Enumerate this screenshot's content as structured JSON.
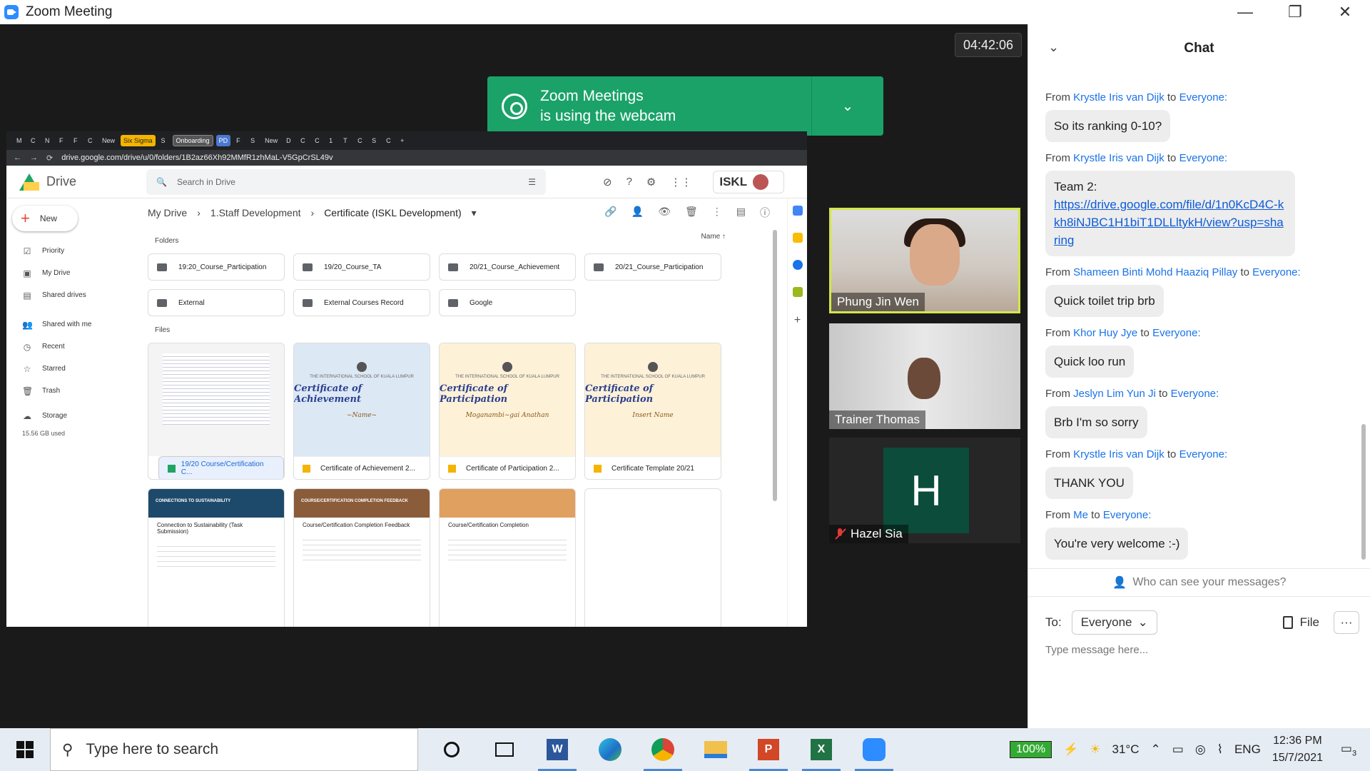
{
  "window": {
    "title": "Zoom Meeting",
    "minimize": "—",
    "restore": "❐",
    "close": "✕"
  },
  "meeting": {
    "timer": "04:42:06"
  },
  "notification": {
    "line1": "Zoom Meetings",
    "line2": "is using the webcam",
    "expand": "⌄"
  },
  "browser": {
    "url": "drive.google.com/drive/u/0/folders/1B2az66Xh92MMfR1zhMaL-V5GpCrSL49v",
    "tabs": [
      "M",
      "C",
      "N",
      "F",
      "F",
      "C",
      "New",
      "Six Sigma",
      "S",
      "Onboarding",
      "PD",
      "F",
      "S",
      "New",
      "D",
      "C",
      "C",
      "1",
      "T",
      "C",
      "S",
      "C",
      "+"
    ]
  },
  "drive": {
    "app_name": "Drive",
    "search_placeholder": "Search in Drive",
    "brand": "ISKL",
    "new_label": "New",
    "sidebar": [
      {
        "label": "Priority",
        "icon": "priority-icon",
        "glyph": "☑"
      },
      {
        "label": "My Drive",
        "icon": "my-drive-icon",
        "glyph": "▣"
      },
      {
        "label": "Shared drives",
        "icon": "shared-drives-icon",
        "glyph": "▤"
      },
      {
        "label": "Shared with me",
        "icon": "people-icon",
        "glyph": "👥"
      },
      {
        "label": "Recent",
        "icon": "clock-icon",
        "glyph": "◷"
      },
      {
        "label": "Starred",
        "icon": "star-icon",
        "glyph": "☆"
      },
      {
        "label": "Trash",
        "icon": "trash-icon",
        "glyph": "🗑"
      }
    ],
    "storage_label": "Storage",
    "storage_used": "15.56 GB used",
    "breadcrumb": [
      "My Drive",
      "1.Staff Development",
      "Certificate (ISKL Development)"
    ],
    "folders_label": "Folders",
    "sort_label": "Name",
    "folders": [
      "19:20_Course_Participation",
      "19/20_Course_TA",
      "20/21_Course_Achievement",
      "20/21_Course_Participation",
      "External",
      "External Courses Record",
      "Google"
    ],
    "files_label": "Files",
    "files": [
      {
        "name": "19/20 Course/Certification C...",
        "type": "sheet"
      },
      {
        "name": "Certificate of Achievement 2...",
        "type": "slide",
        "cert_title": "Certificate of Achievement",
        "cert_name": "~Name~"
      },
      {
        "name": "Certificate of Participation 2...",
        "type": "slide",
        "cert_title": "Certificate of Participation",
        "cert_name": "Moganambi~gai Anathan"
      },
      {
        "name": "Certificate Template 20/21",
        "type": "slide",
        "cert_title": "Certificate of Participation",
        "cert_name": "Insert Name"
      }
    ],
    "cert_school": "THE INTERNATIONAL SCHOOL OF KUALA LUMPUR",
    "forms": [
      {
        "title": "Connection to Sustainability (Task Submission)",
        "banner": "CONNECTIONS TO SUSTAINABILITY"
      },
      {
        "title": "Course/Certification Completion Feedback",
        "banner": "COURSE/CERTIFICATION COMPLETION FEEDBACK"
      },
      {
        "title": "Course/Certification Completion",
        "banner": ""
      }
    ]
  },
  "participants": [
    {
      "name": "Phung Jin Wen"
    },
    {
      "name": "Trainer Thomas"
    },
    {
      "name": "Hazel Sia",
      "initial": "H"
    }
  ],
  "chat": {
    "title": "Chat",
    "messages": [
      {
        "from": "Krystle Iris van Dijk",
        "to": "Everyone",
        "text": "So its ranking 0-10?"
      },
      {
        "from": "Krystle Iris van Dijk",
        "to": "Everyone",
        "text": "Team 2:",
        "link": "https://drive.google.com/file/d/1n0KcD4C-kkh8iNJBC1H1biT1DLLltykH/view?usp=sharing"
      },
      {
        "from": "Shameen Binti Mohd Haaziq Pillay",
        "to": "Everyone",
        "text": "Quick toilet trip brb"
      },
      {
        "from": "Khor Huy Jye",
        "to": "Everyone",
        "text": "Quick loo run"
      },
      {
        "from": "Jeslyn Lim Yun Ji",
        "to": "Everyone",
        "text": "Brb I'm so sorry"
      },
      {
        "from": "Krystle Iris van Dijk",
        "to": "Everyone",
        "text": "THANK YOU"
      },
      {
        "from": "Me",
        "to": "Everyone",
        "text": "You're very welcome :-)"
      }
    ],
    "from_word": "From",
    "to_word": "to",
    "who_can_see": "Who can see your messages?",
    "to_label": "To:",
    "recipient": "Everyone",
    "file_label": "File",
    "more_label": "···",
    "input_placeholder": "Type message here..."
  },
  "taskbar": {
    "search_placeholder": "Type here to search",
    "battery": "100%",
    "temperature": "31°C",
    "language": "ENG",
    "time": "12:36 PM",
    "date": "15/7/2021",
    "notifications": "3"
  }
}
